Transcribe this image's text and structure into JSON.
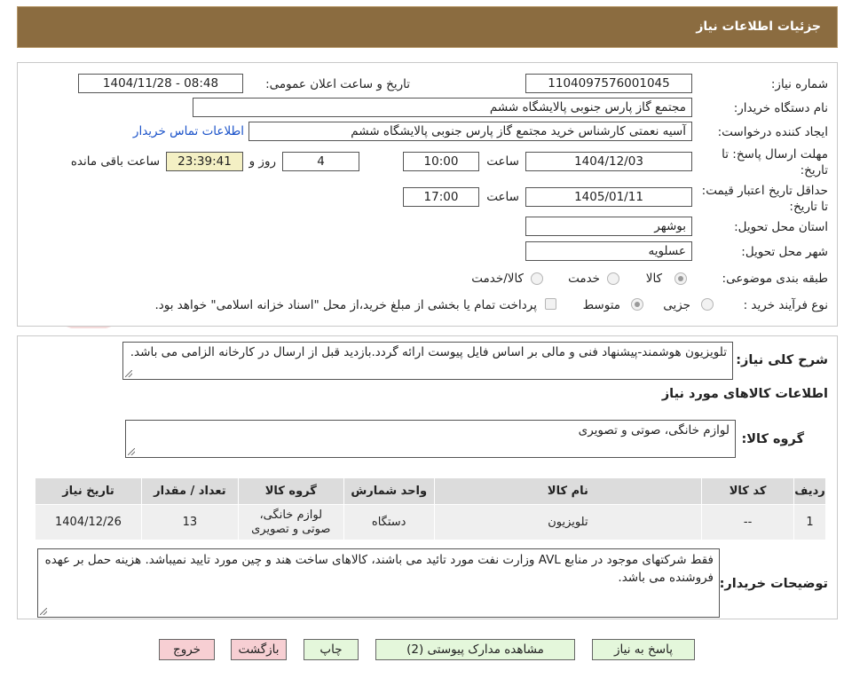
{
  "header": {
    "title": "جزئیات اطلاعات نیاز"
  },
  "watermark": {
    "text": "AriaTender.neT"
  },
  "form": {
    "need_number": {
      "label": "شماره نیاز:",
      "value": "1104097576001045"
    },
    "announce": {
      "label": "تاریخ و ساعت اعلان عمومی:",
      "value": "1404/11/28 - 08:48"
    },
    "buyer_org": {
      "label": "نام دستگاه خریدار:",
      "value": "مجتمع گاز پارس جنوبی  پالایشگاه ششم"
    },
    "requester": {
      "label": "ایجاد کننده درخواست:",
      "value": "آسیه نعمتی کارشناس خرید مجتمع گاز پارس جنوبی  پالایشگاه ششم",
      "contact_link": "اطلاعات تماس خریدار"
    },
    "reply_deadline": {
      "label": "مهلت ارسال پاسخ: تا تاریخ:",
      "date": "1404/12/03",
      "time_label": "ساعت",
      "time": "10:00",
      "days": "4",
      "days_label": "روز و",
      "remaining": "23:39:41",
      "remaining_label": "ساعت باقی مانده"
    },
    "price_validity": {
      "label": "حداقل تاریخ اعتبار قیمت: تا تاریخ:",
      "date": "1405/01/11",
      "time_label": "ساعت",
      "time": "17:00"
    },
    "province": {
      "label": "استان محل تحویل:",
      "value": "بوشهر"
    },
    "city": {
      "label": "شهر محل تحویل:",
      "value": "عسلویه"
    },
    "category": {
      "label": "طبقه بندی موضوعی:",
      "options": [
        "کالا",
        "خدمت",
        "کالا/خدمت"
      ],
      "selected": "کالا"
    },
    "process": {
      "label": "نوع فرآیند خرید :",
      "options": [
        "جزیی",
        "متوسط"
      ],
      "selected": "متوسط",
      "note": "پرداخت تمام یا بخشی از مبلغ خرید،از محل \"اسناد خزانه اسلامی\" خواهد بود."
    }
  },
  "description": {
    "label": "شرح کلی نیاز:",
    "value": "تلویزیون هوشمند-پیشنهاد فنی و مالی بر اساس فایل پیوست ارائه گردد.بازدید قبل از ارسال در کارخانه الزامی می باشد."
  },
  "goods": {
    "section_title": "اطلاعات کالاهای مورد نیاز",
    "group_label": "گروه کالا:",
    "group_value": "لوازم خانگی، صوتی و تصویری",
    "table": {
      "headers": [
        "ردیف",
        "کد کالا",
        "نام کالا",
        "واحد شمارش",
        "گروه کالا",
        "تعداد / مقدار",
        "تاریخ نیاز"
      ],
      "rows": [
        [
          "1",
          "--",
          "تلویزیون",
          "دستگاه",
          "لوازم خانگی، صوتی و تصویری",
          "13",
          "1404/12/26"
        ]
      ]
    }
  },
  "buyer_notes": {
    "label": "توضیحات خریدار:",
    "value": "فقط شرکتهای موجود در منابع AVL وزارت نفت مورد تائید می باشند، کالاهای ساخت هند و چین مورد تایید نمیباشد. هزینه حمل بر عهده فروشنده می باشد."
  },
  "buttons": {
    "reply": "پاسخ به نیاز",
    "attachments": "مشاهده مدارک پیوستی (2)",
    "print": "چاپ",
    "back": "بازگشت",
    "exit": "خروج"
  }
}
